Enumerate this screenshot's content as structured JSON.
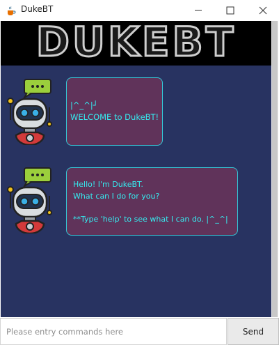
{
  "window": {
    "title": "DukeBT",
    "icon": "java-cup-icon"
  },
  "banner": {
    "text": "DUKEBT"
  },
  "messages": [
    {
      "sender": "bot",
      "avatar": "robot-icon",
      "lines": [
        "|^_^|┘",
        "WELCOME to DukeBT!"
      ]
    },
    {
      "sender": "bot",
      "avatar": "robot-icon",
      "lines": [
        "Hello! I'm DukeBT.",
        "What can I do for you?",
        "",
        "**Type 'help' to see what I can do. |^_^|"
      ]
    }
  ],
  "input": {
    "value": "",
    "placeholder": "Please entry commands here"
  },
  "send_button": {
    "label": "Send"
  },
  "colors": {
    "chat_background": "#283361",
    "bubble_background": "#60335a",
    "bubble_border": "#35c8d6",
    "bubble_text": "#35ecf0"
  }
}
